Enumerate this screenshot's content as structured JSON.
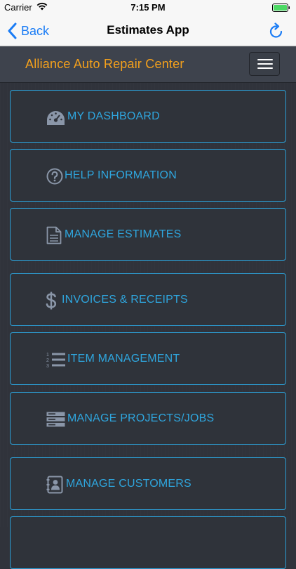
{
  "status_bar": {
    "carrier": "Carrier",
    "time": "7:15 PM"
  },
  "nav": {
    "back_label": "Back",
    "title": "Estimates App",
    "accent_color": "#1a7cf5"
  },
  "header": {
    "brand": "Alliance Auto Repair Center",
    "brand_color": "#f3a01c"
  },
  "menu": {
    "accent_color": "#2c9fd6",
    "items": [
      {
        "label": "MY DASHBOARD",
        "icon": "dashboard-gauge-icon"
      },
      {
        "label": "HELP INFORMATION",
        "icon": "question-circle-icon"
      },
      {
        "label": "MANAGE ESTIMATES",
        "icon": "document-icon"
      },
      {
        "label": "INVOICES & RECEIPTS",
        "icon": "dollar-icon"
      },
      {
        "label": "ITEM MANAGEMENT",
        "icon": "numbered-list-icon"
      },
      {
        "label": "MANAGE PROJECTS/JOBS",
        "icon": "server-stack-icon"
      },
      {
        "label": "MANAGE CUSTOMERS",
        "icon": "contact-book-icon"
      }
    ]
  }
}
